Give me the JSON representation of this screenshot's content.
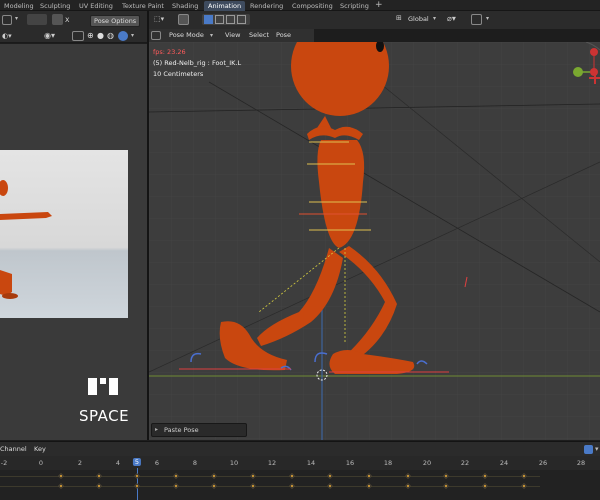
{
  "workspace_tabs": [
    "Modeling",
    "Sculpting",
    "UV Editing",
    "Texture Paint",
    "Shading",
    "Animation",
    "Rendering",
    "Compositing",
    "Scripting"
  ],
  "active_tab": "Animation",
  "left_header": {
    "pose_options": "Pose Options",
    "x_label": "X"
  },
  "viewport_header": {
    "transform_orientation": "Global",
    "mode": "Pose Mode",
    "menus": [
      "View",
      "Select",
      "Pose"
    ]
  },
  "overlay": {
    "fps": "fps: 23.26",
    "object": "(5) Red-Nelb_rig : Foot_IK.L",
    "scale": "10 Centimeters"
  },
  "last_operator": "Paste Pose",
  "brand": {
    "text": "SPACE"
  },
  "timeline": {
    "menus": [
      "Channel",
      "Key"
    ],
    "ticks": [
      "-2",
      "0",
      "2",
      "4",
      "5",
      "6",
      "8",
      "10",
      "12",
      "14",
      "16",
      "18",
      "20",
      "22",
      "24",
      "26",
      "28"
    ],
    "current_frame": "5"
  },
  "colors": {
    "character": "#c9470f",
    "active_tab": "#3e4b5e",
    "keyframe": "#e1a535",
    "current_frame": "#4a7ac7",
    "fps_text": "#ff5b5b"
  }
}
